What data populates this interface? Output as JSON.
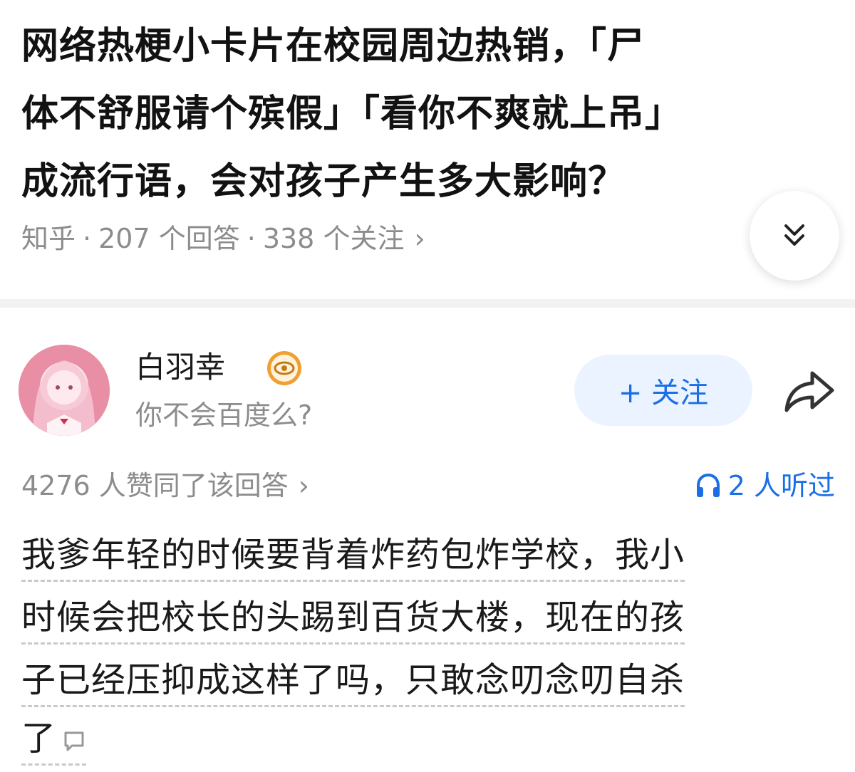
{
  "question": {
    "line1": "网络热梗小卡片在校园周边热销，「尸",
    "line2": "体不舒服请个殡假」「看你不爽就上吊」",
    "line3": "成流行语，会对孩子产生多大影响？"
  },
  "meta": {
    "source": "知乎",
    "separator": "·",
    "answers": "207 个回答",
    "followers": "338 个关注",
    "chevron": "›"
  },
  "icons": {
    "expand": "double-chevron-down-icon",
    "badge": "eye-badge-icon",
    "share": "share-arrow-icon",
    "headphones": "headphones-icon",
    "comment": "comment-icon"
  },
  "author": {
    "name": "白羽幸",
    "bio": "你不会百度么?",
    "follow_label": "+ 关注"
  },
  "stats": {
    "votes": "4276 人赞同了该回答",
    "chevron": "›",
    "listens": "2 人听过"
  },
  "answer": {
    "line1": "我爹年轻的时候要背着炸药包炸学校，我小",
    "line2": "时候会把校长的头踢到百货大楼，现在的孩",
    "line3": "子已经压抑成这样了吗，只敢念叨念叨自杀",
    "line4": "了"
  },
  "colors": {
    "accent": "#1a6fe8",
    "follow_bg": "#eaf3ff",
    "muted_text": "#8c8c8c",
    "badge": "#f0a030"
  }
}
